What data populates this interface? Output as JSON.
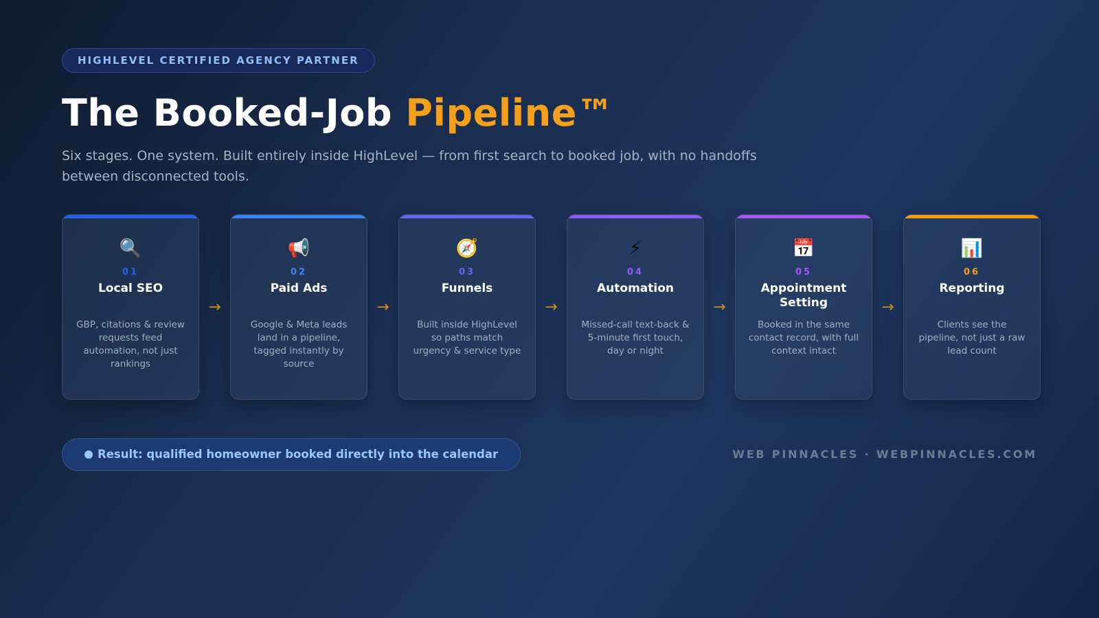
{
  "badge": "HIGHLEVEL CERTIFIED AGENCY PARTNER",
  "headline": {
    "main": "The Booked-Job ",
    "accent": "Pipeline™"
  },
  "subtitle": "Six stages. One system. Built entirely inside HighLevel — from first search to booked job, with no handoffs between disconnected tools.",
  "arrow": "→",
  "stages": [
    {
      "num": "01",
      "title": "Local SEO",
      "icon": "🔍",
      "icon_name": "magnifier-icon",
      "color": "#2563eb",
      "desc": "GBP, citations & review requests feed automation, not just rankings"
    },
    {
      "num": "02",
      "title": "Paid Ads",
      "icon": "📢",
      "icon_name": "megaphone-icon",
      "color": "#3b82f6",
      "desc": "Google & Meta leads land in a pipeline, tagged instantly by source"
    },
    {
      "num": "03",
      "title": "Funnels",
      "icon": "🧭",
      "icon_name": "compass-icon",
      "color": "#6366f1",
      "desc": "Built inside HighLevel so paths match urgency & service type"
    },
    {
      "num": "04",
      "title": "Automation",
      "icon": "⚡",
      "icon_name": "lightning-icon",
      "color": "#8b5cf6",
      "desc": "Missed-call text-back & 5-minute first touch, day or night"
    },
    {
      "num": "05",
      "title": "Appointment Setting",
      "icon": "📅",
      "icon_name": "calendar-icon",
      "color": "#a855f7",
      "desc": "Booked in the same contact record, with full context intact"
    },
    {
      "num": "06",
      "title": "Reporting",
      "icon": "📊",
      "icon_name": "bar-chart-icon",
      "color": "#f59e0b",
      "desc": "Clients see the pipeline, not just a raw lead count"
    }
  ],
  "result": "Result: qualified homeowner booked directly into the calendar",
  "brand": "WEB PINNACLES · WEBPINNACLES.COM"
}
